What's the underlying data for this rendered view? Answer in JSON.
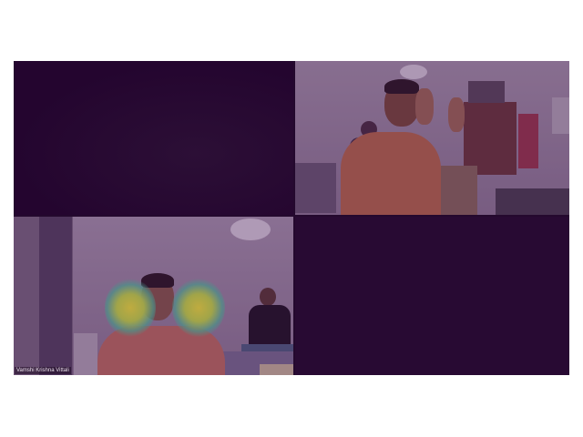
{
  "meeting": {
    "participants": [
      {
        "id": "p1",
        "name": "",
        "video": "dark"
      },
      {
        "id": "p2",
        "name": "",
        "video": "on"
      },
      {
        "id": "p3",
        "name": "Vamshi Krishna Vittali",
        "video": "on"
      },
      {
        "id": "p4",
        "name": "",
        "video": "dark"
      }
    ]
  },
  "colors": {
    "grid_background": "#24092e",
    "tile_overlay": "#3c0a50",
    "hand_glow": "#f2ea3a"
  }
}
